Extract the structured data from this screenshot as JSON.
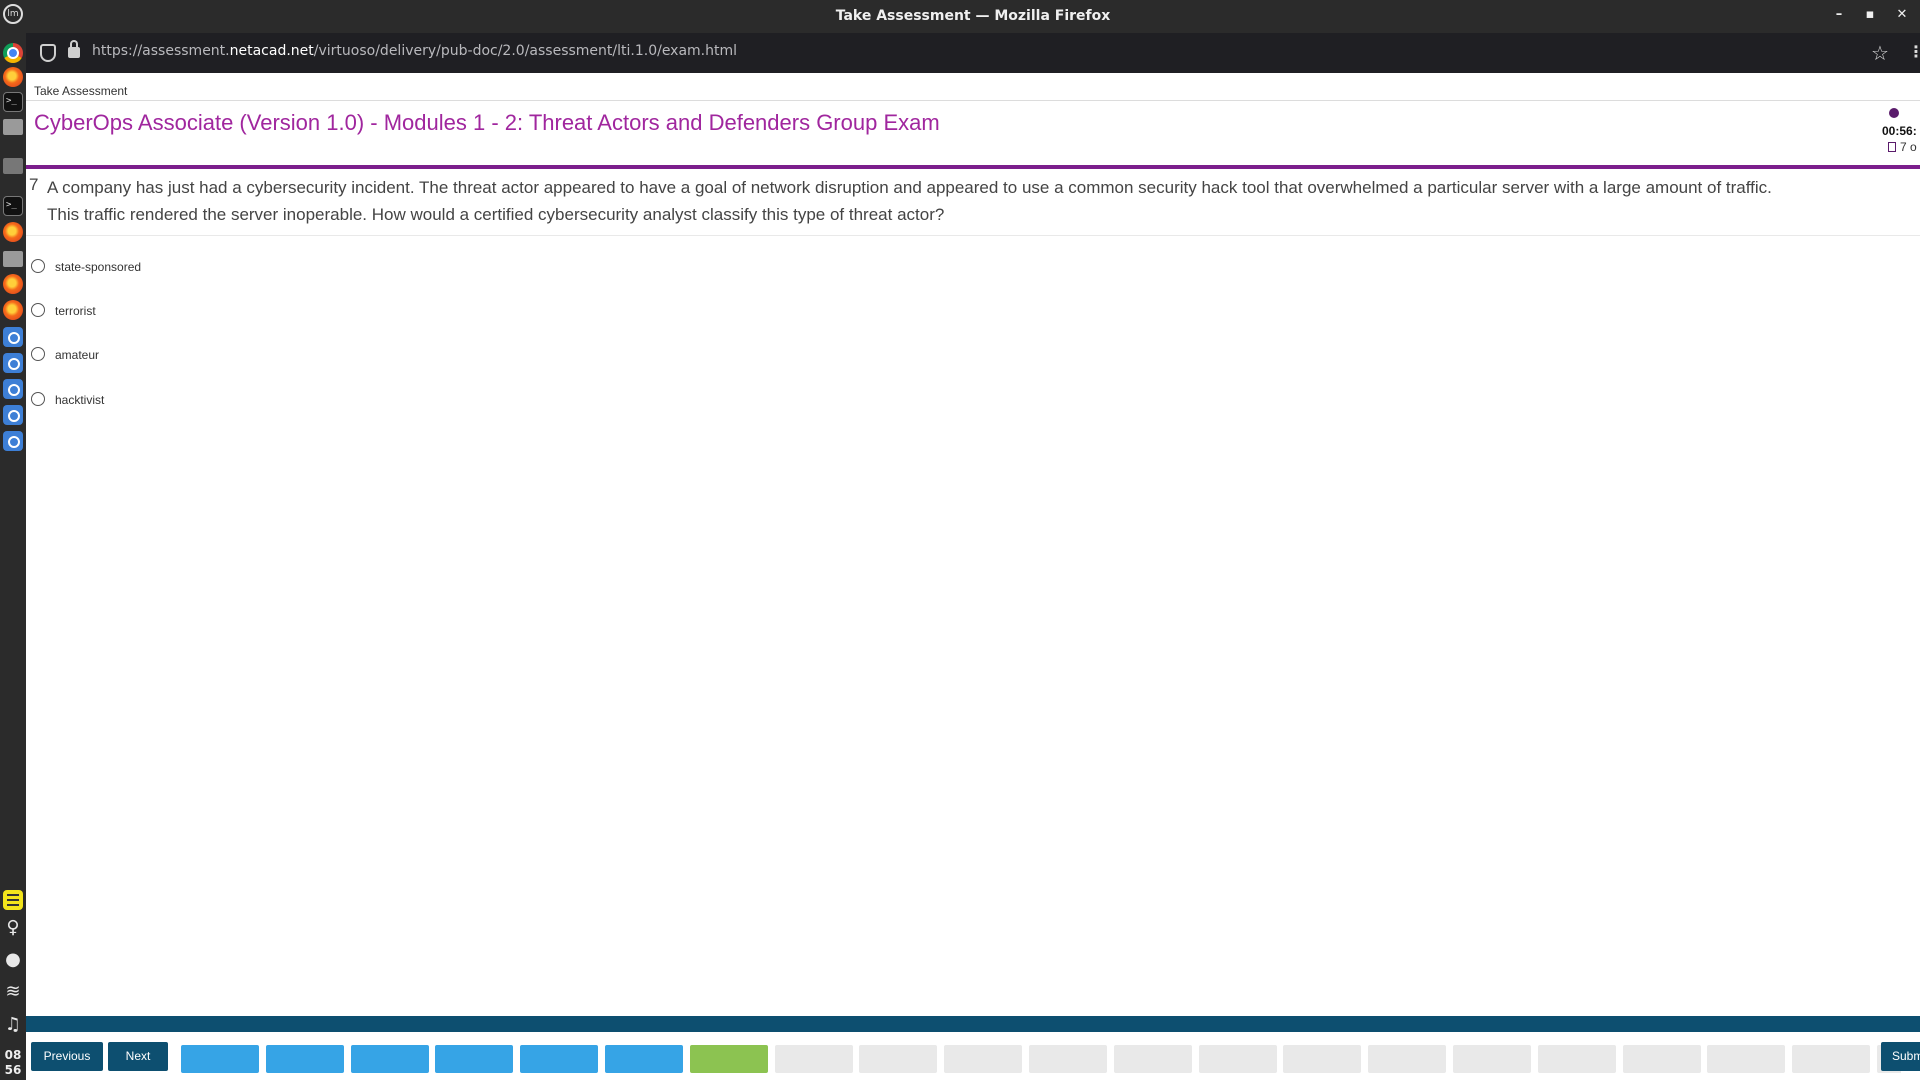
{
  "window": {
    "title": "Take Assessment — Mozilla Firefox",
    "minimize_icon": "–",
    "maximize_icon": "▪",
    "close_icon": "✕"
  },
  "browser": {
    "url_prefix": "https://assessment.",
    "url_domain": "netacad.net",
    "url_path": "/virtuoso/delivery/pub-doc/2.0/assessment/lti.1.0/exam.html"
  },
  "desktop": {
    "clock_hour": "08",
    "clock_minute": "56"
  },
  "page": {
    "tab_title": "Take Assessment",
    "exam_title": "CyberOps Associate (Version 1.0) - Modules 1 - 2: Threat Actors and Defenders Group Exam",
    "timer": "00:56:",
    "question_counter": "7 o",
    "brand_color": "#a0269e",
    "accent_color": "#0d4f70"
  },
  "question": {
    "number": "7",
    "text": "A company has just had a cybersecurity incident. The threat actor appeared to have a goal of network disruption and appeared to use a common security hack tool that overwhelmed a particular server with a large amount of traffic. This traffic rendered the server inoperable. How would a certified cybersecurity analyst classify this type of threat actor?",
    "options": [
      "state-sponsored",
      "terrorist",
      "amateur",
      "hacktivist"
    ]
  },
  "navigation": {
    "previous_label": "Previous",
    "next_label": "Next",
    "submit_label": "Submit",
    "answered_color": "#36a4e6",
    "current_color": "#8cc351",
    "unanswered_color": "#e9e9e9",
    "question_states": [
      "answered",
      "answered",
      "answered",
      "answered",
      "answered",
      "answered",
      "current",
      "unanswered",
      "unanswered",
      "unanswered",
      "unanswered",
      "unanswered",
      "unanswered",
      "unanswered",
      "unanswered",
      "unanswered",
      "unanswered",
      "unanswered",
      "unanswered",
      "unanswered",
      "unanswered",
      "unanswered"
    ]
  }
}
